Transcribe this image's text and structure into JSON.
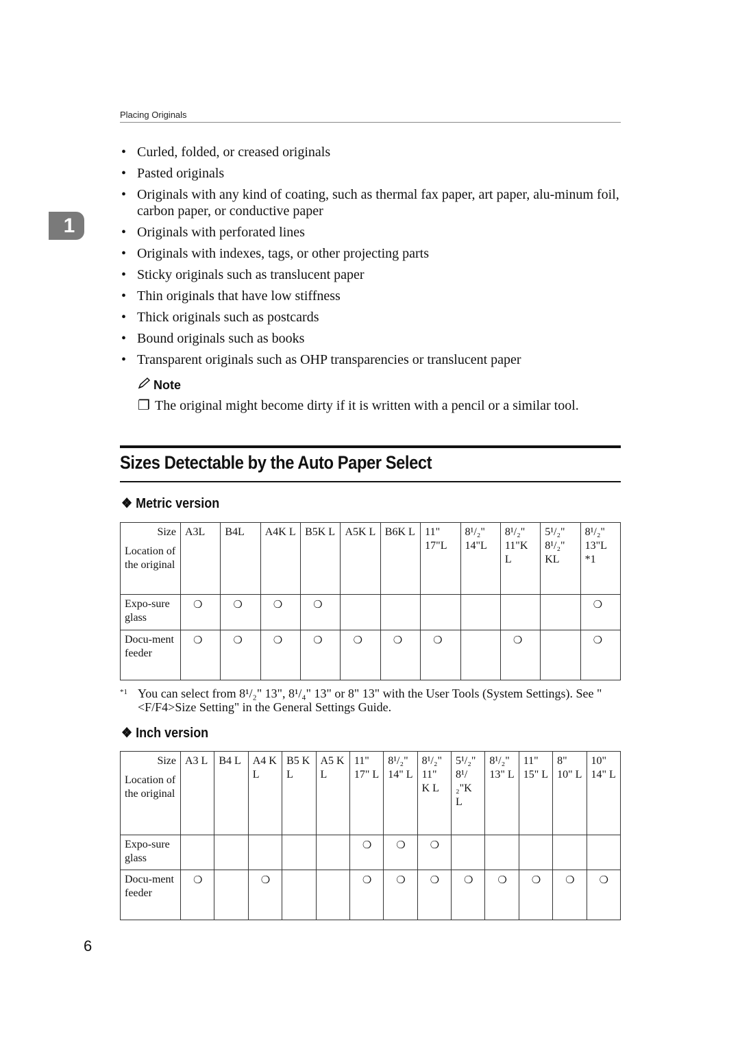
{
  "running_head": "Placing Originals",
  "chapter_tab": "1",
  "bullets": [
    "Curled, folded, or creased originals",
    "Pasted originals",
    "Originals with any kind of coating, such as thermal fax paper, art paper, alu-minum foil, carbon paper, or conductive paper",
    "Originals with perforated lines",
    "Originals with indexes, tags, or other projecting parts",
    "Sticky originals such as translucent paper",
    "Thin originals that have low stiffness",
    "Thick originals such as postcards",
    "Bound originals such as books",
    "Transparent originals such as OHP transparencies or translucent paper"
  ],
  "bullet_glyph": "•",
  "note": {
    "label": "Note",
    "icon": "pencil-icon",
    "checkbox_glyph": "❐",
    "text": "The original might become dirty if it is written with a pencil or a similar tool."
  },
  "section_title": "Sizes Detectable by the Auto Paper Select",
  "diamond_glyph": "❖",
  "metric": {
    "heading": "Metric version",
    "corner_size": "Size",
    "corner_location": "Location of the original",
    "columns": [
      "A3L",
      "B4L",
      "A4K L",
      "B5K L",
      "A5K L",
      "B6K L",
      "11\" 17\"L",
      "8¹/₂\" 14\"L",
      "8¹/₂\" 11\"K L",
      "5¹/₂\" 8¹/₂\" KL",
      "8¹/₂\" 13\"L *1"
    ],
    "rows": [
      {
        "label": "Expo-sure glass",
        "marks": [
          true,
          true,
          true,
          true,
          false,
          false,
          false,
          false,
          false,
          false,
          true
        ]
      },
      {
        "label": "Docu-ment feeder",
        "marks": [
          true,
          true,
          true,
          true,
          true,
          true,
          true,
          false,
          true,
          false,
          true
        ]
      }
    ],
    "mark_glyph": "❍"
  },
  "footnote": {
    "marker": "*1",
    "text": "You can select from 8¹/₂\" 13\", 8¹/₄\" 13\" or 8\" 13\" with the User Tools (System Settings). See \"<F/F4>Size Setting\" in the General Settings Guide."
  },
  "inch": {
    "heading": "Inch version",
    "corner_size": "Size",
    "corner_location": "Location of the original",
    "columns": [
      "A3 L",
      "B4 L",
      "A4 K L",
      "B5 K L",
      "A5 K L",
      "11\" 17\" L",
      "8¹/₂\" 14\" L",
      "8¹/₂\" 11\" K L",
      "5¹/₂\" 8¹/₂\"K L",
      "8¹/₂\" 13\" L",
      "11\" 15\" L",
      "8\" 10\" L",
      "10\" 14\" L"
    ],
    "rows": [
      {
        "label": "Expo-sure glass",
        "marks": [
          false,
          false,
          false,
          false,
          false,
          true,
          true,
          true,
          false,
          false,
          false,
          false,
          false
        ]
      },
      {
        "label": "Docu-ment feeder",
        "marks": [
          true,
          false,
          true,
          false,
          false,
          true,
          true,
          true,
          true,
          true,
          true,
          true,
          true
        ]
      }
    ],
    "mark_glyph": "❍"
  },
  "page_number": "6"
}
